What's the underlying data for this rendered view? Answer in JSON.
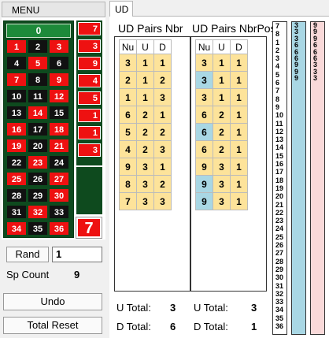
{
  "menu": {
    "label": "MENU"
  },
  "board": {
    "zero": "0",
    "rows": [
      [
        {
          "n": "1",
          "c": "red"
        },
        {
          "n": "2",
          "c": "blk"
        },
        {
          "n": "3",
          "c": "red"
        }
      ],
      [
        {
          "n": "4",
          "c": "blk"
        },
        {
          "n": "5",
          "c": "red"
        },
        {
          "n": "6",
          "c": "blk"
        }
      ],
      [
        {
          "n": "7",
          "c": "red"
        },
        {
          "n": "8",
          "c": "blk"
        },
        {
          "n": "9",
          "c": "red"
        }
      ],
      [
        {
          "n": "10",
          "c": "blk"
        },
        {
          "n": "11",
          "c": "blk"
        },
        {
          "n": "12",
          "c": "red"
        }
      ],
      [
        {
          "n": "13",
          "c": "blk"
        },
        {
          "n": "14",
          "c": "red"
        },
        {
          "n": "15",
          "c": "blk"
        }
      ],
      [
        {
          "n": "16",
          "c": "red"
        },
        {
          "n": "17",
          "c": "blk"
        },
        {
          "n": "18",
          "c": "red"
        }
      ],
      [
        {
          "n": "19",
          "c": "red"
        },
        {
          "n": "20",
          "c": "blk"
        },
        {
          "n": "21",
          "c": "red"
        }
      ],
      [
        {
          "n": "22",
          "c": "blk"
        },
        {
          "n": "23",
          "c": "red"
        },
        {
          "n": "24",
          "c": "blk"
        }
      ],
      [
        {
          "n": "25",
          "c": "red"
        },
        {
          "n": "26",
          "c": "blk"
        },
        {
          "n": "27",
          "c": "red"
        }
      ],
      [
        {
          "n": "28",
          "c": "blk"
        },
        {
          "n": "29",
          "c": "blk"
        },
        {
          "n": "30",
          "c": "red"
        }
      ],
      [
        {
          "n": "31",
          "c": "blk"
        },
        {
          "n": "32",
          "c": "red"
        },
        {
          "n": "33",
          "c": "blk"
        }
      ],
      [
        {
          "n": "34",
          "c": "red"
        },
        {
          "n": "35",
          "c": "blk"
        },
        {
          "n": "36",
          "c": "red"
        }
      ]
    ]
  },
  "history": [
    "7",
    "3",
    "9",
    "4",
    "5",
    "1",
    "1",
    "3"
  ],
  "last_number": "7",
  "controls": {
    "rand_label": "Rand",
    "rand_value": "1",
    "sp_count_label": "Sp Count",
    "sp_count_value": "9",
    "undo_label": "Undo",
    "reset_label": "Total Reset"
  },
  "tab": {
    "label": "UD"
  },
  "ud_nbr": {
    "title": "UD Pairs Nbr",
    "headers": [
      "Nu",
      "U",
      "D"
    ],
    "rows": [
      [
        "3",
        "1",
        "1"
      ],
      [
        "2",
        "1",
        "2"
      ],
      [
        "1",
        "1",
        "3"
      ],
      [
        "6",
        "2",
        "1"
      ],
      [
        "5",
        "2",
        "2"
      ],
      [
        "4",
        "2",
        "3"
      ],
      [
        "9",
        "3",
        "1"
      ],
      [
        "8",
        "3",
        "2"
      ],
      [
        "7",
        "3",
        "3"
      ]
    ],
    "u_total_label": "U Total:",
    "u_total": "3",
    "d_total_label": "D Total:",
    "d_total": "6"
  },
  "ud_pos": {
    "title": "UD Pairs NbrPos",
    "headers": [
      "Nu",
      "U",
      "D"
    ],
    "rows": [
      [
        "3",
        "1",
        "1"
      ],
      [
        "3",
        "1",
        "1"
      ],
      [
        "3",
        "1",
        "1"
      ],
      [
        "6",
        "2",
        "1"
      ],
      [
        "6",
        "2",
        "1"
      ],
      [
        "6",
        "2",
        "1"
      ],
      [
        "9",
        "3",
        "1"
      ],
      [
        "9",
        "3",
        "1"
      ],
      [
        "9",
        "3",
        "1"
      ]
    ],
    "blue_rows": [
      1,
      4,
      7,
      8
    ],
    "u_total_label": "U Total:",
    "u_total": "3",
    "d_total_label": "D Total:",
    "d_total": "1"
  },
  "strip_numbers": [
    "7",
    "8",
    "1",
    "2",
    "3",
    "4",
    "5",
    "6",
    "7",
    "8",
    "9",
    "10",
    "11",
    "12",
    "13",
    "14",
    "15",
    "16",
    "17",
    "18",
    "19",
    "20",
    "21",
    "22",
    "23",
    "24",
    "25",
    "26",
    "27",
    "28",
    "29",
    "30",
    "31",
    "32",
    "33",
    "34",
    "35",
    "36"
  ],
  "strip_blue": [
    "3",
    "3",
    "3",
    "6",
    "6",
    "6",
    "9",
    "9",
    "9"
  ],
  "strip_pink": [
    "9",
    "9",
    "9",
    "6",
    "6",
    "6",
    "3",
    "3",
    "3"
  ],
  "colors": {
    "red": "#ee1111",
    "green": "#0e4a1e",
    "yellow": "#fde39a",
    "blue": "#a9d7e4",
    "pink": "#f9d9d9"
  }
}
